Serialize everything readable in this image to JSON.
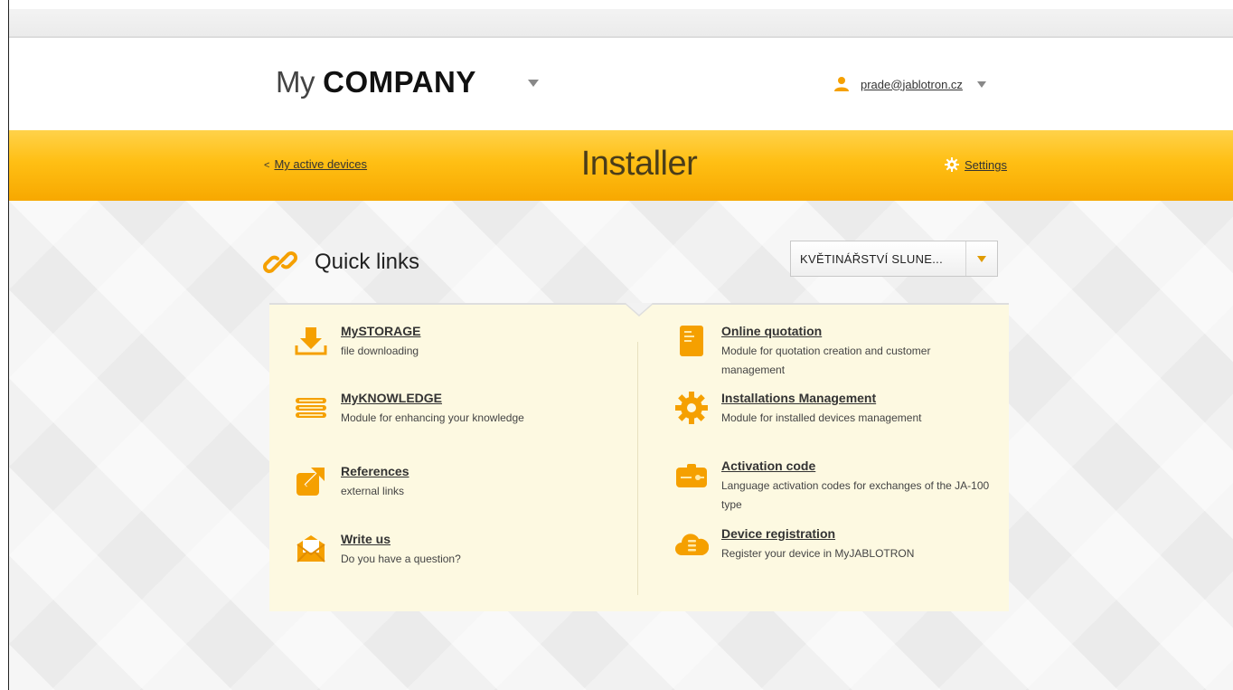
{
  "header": {
    "logo_light": "My",
    "logo_bold": "COMPANY",
    "user_email": "prade@jablotron.cz"
  },
  "band": {
    "back_link": "My active devices",
    "title": "Installer",
    "settings_label": "Settings"
  },
  "quick_links": {
    "title": "Quick links",
    "device_select": "KVĚTINÁŘSTVÍ SLUNE..."
  },
  "items_left": [
    {
      "title": "MySTORAGE",
      "desc": "file downloading",
      "icon": "download-icon"
    },
    {
      "title": "MyKNOWLEDGE",
      "desc": "Module for enhancing your knowledge",
      "icon": "books-icon"
    },
    {
      "title": "References",
      "desc": "external links",
      "icon": "external-link-icon"
    },
    {
      "title": "Write us",
      "desc": "Do you have a question?",
      "icon": "envelope-icon"
    }
  ],
  "items_right": [
    {
      "title": "Online quotation",
      "desc": "Module for quotation creation and customer management",
      "icon": "document-icon"
    },
    {
      "title": "Installations Management",
      "desc": "Module for installed devices management",
      "icon": "gear-icon"
    },
    {
      "title": "Activation code",
      "desc": "Language activation codes for exchanges of the JA-100 type",
      "icon": "key-card-icon"
    },
    {
      "title": "Device registration",
      "desc": "Register your device in MyJABLOTRON",
      "icon": "cloud-icon"
    }
  ],
  "colors": {
    "accent": "#ffbf14",
    "icon_orange": "#f5a000",
    "panel_bg": "#fdf9e1"
  }
}
